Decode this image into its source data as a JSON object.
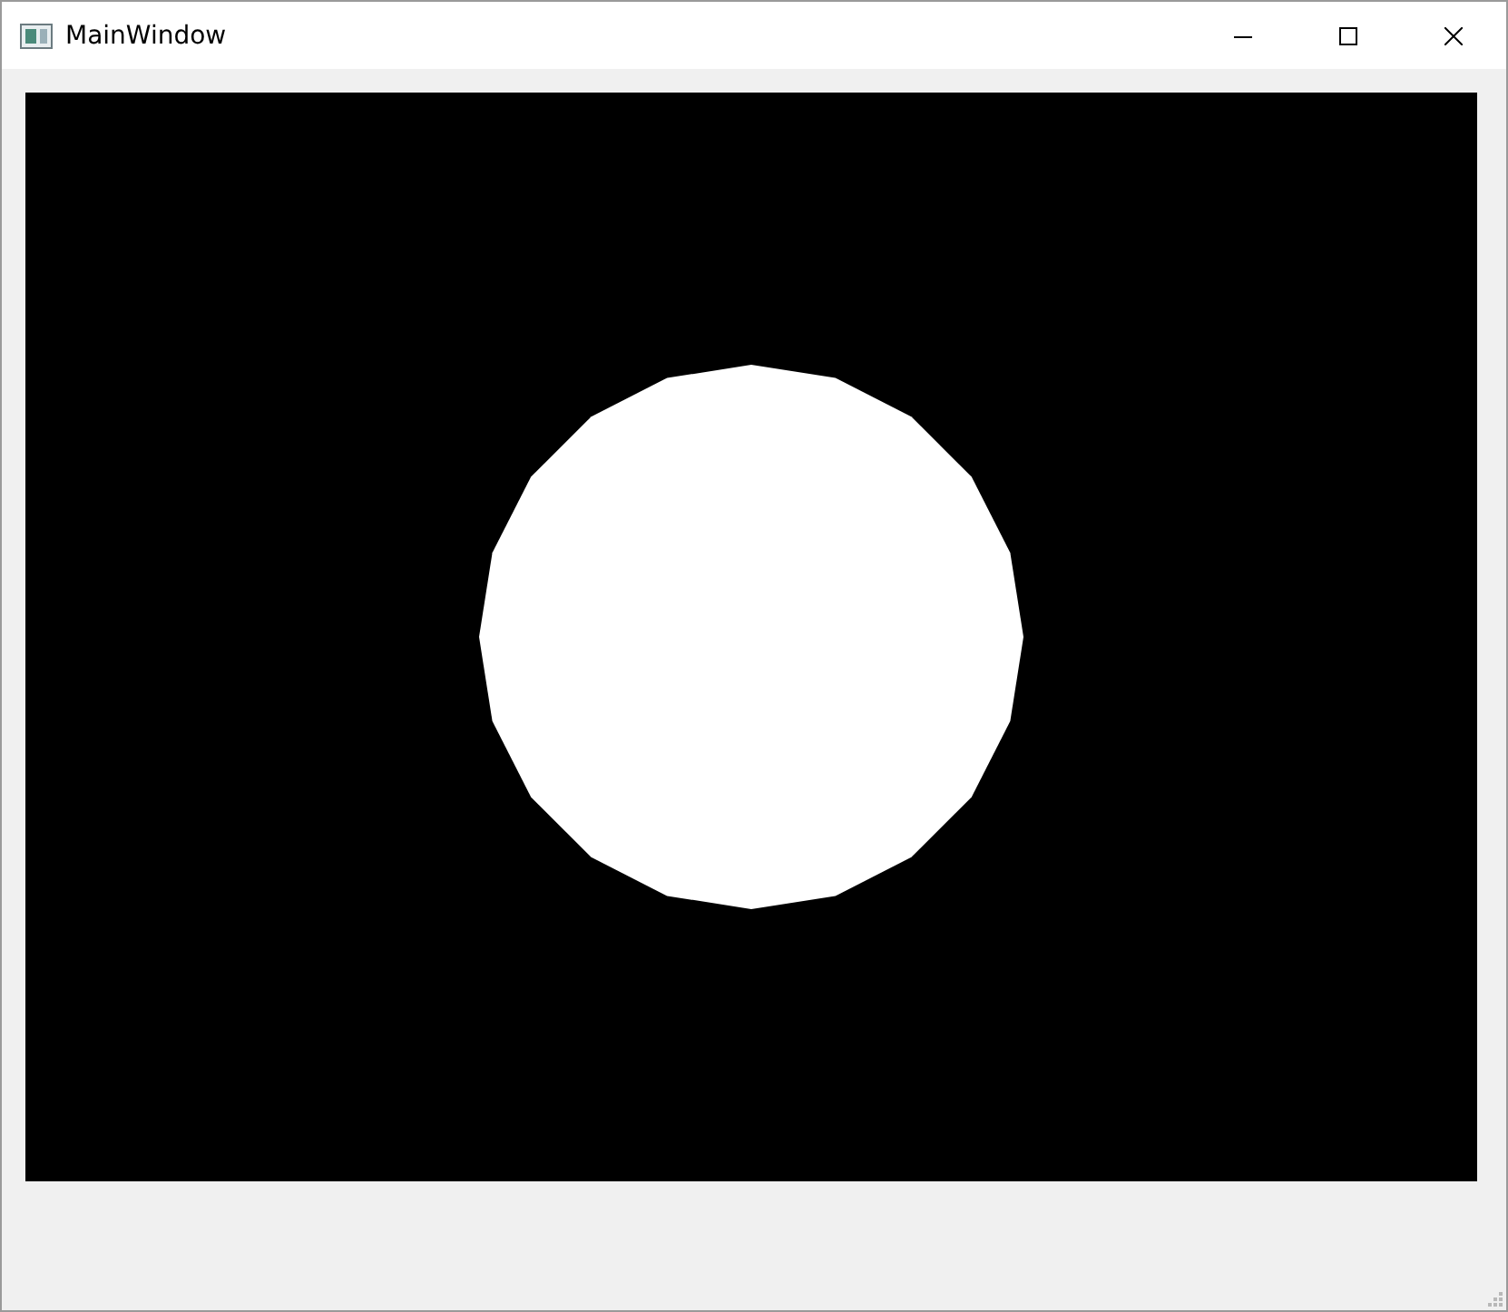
{
  "window": {
    "title": "MainWindow"
  }
}
